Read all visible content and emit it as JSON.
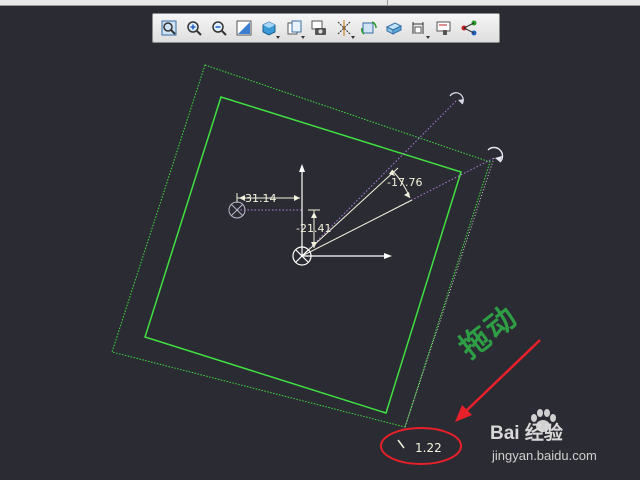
{
  "toolbar": {
    "items": [
      {
        "name": "zoom-fit-icon"
      },
      {
        "name": "zoom-in-icon"
      },
      {
        "name": "zoom-out-icon"
      },
      {
        "name": "repaint-icon"
      },
      {
        "name": "display-style-icon",
        "dropdown": true
      },
      {
        "name": "named-views-icon",
        "dropdown": true
      },
      {
        "name": "screenshot-camera-icon"
      },
      {
        "name": "datum-display-icon",
        "dropdown": true
      },
      {
        "name": "spin-center-icon"
      },
      {
        "name": "view-orientation-icon"
      },
      {
        "name": "dimension-display-icon",
        "dropdown": true
      },
      {
        "name": "sketch-view-icon"
      },
      {
        "name": "relations-icon"
      }
    ]
  },
  "sketch": {
    "line_color": "#40e040",
    "dim_color": "#f2f2dc",
    "dimensions": {
      "horizontal": "31.14",
      "vertical": "-21.41",
      "angle": "-17.76",
      "drag_value": "1.22"
    }
  },
  "annotation": {
    "text": "拖动",
    "color": "#2e9e45",
    "arrow_color": "#e8202a",
    "ellipse_color": "#e8202a"
  },
  "watermark": {
    "brand": "Bai 经验",
    "site": "jingyan.baidu.com"
  }
}
